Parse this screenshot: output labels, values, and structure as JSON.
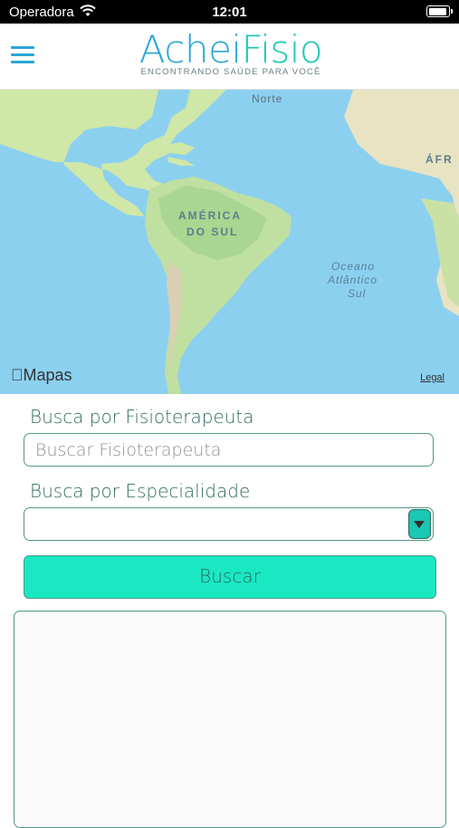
{
  "status_bar": {
    "carrier": "Operadora",
    "time": "12:01",
    "battery_level": 0.9
  },
  "header": {
    "menu_icon": "hamburger-icon",
    "logo_primary": "Achei",
    "logo_accent": "Fisio",
    "tagline": "ENCONTRANDO SAÚDE PARA VOCÊ"
  },
  "map": {
    "labels": {
      "north": "Norte",
      "continent_line1": "AMÉRICA",
      "continent_line2": "DO SUL",
      "africa": "ÁFR",
      "ocean_line1": "Oceano",
      "ocean_line2": "Atlântico",
      "ocean_line3": "Sul"
    },
    "attribution": "Mapas",
    "legal": "Legal"
  },
  "search_form": {
    "therapist_label": "Busca por Fisioterapeuta",
    "therapist_placeholder": "Buscar Fisioterapeuta",
    "specialty_label": "Busca por Especialidade",
    "specialty_selected": "",
    "search_button": "Buscar"
  },
  "colors": {
    "primary_blue": "#2aa6d6",
    "accent_teal": "#19e8c3",
    "border_green": "#4f9a86",
    "label_green": "#2f6b5f"
  }
}
